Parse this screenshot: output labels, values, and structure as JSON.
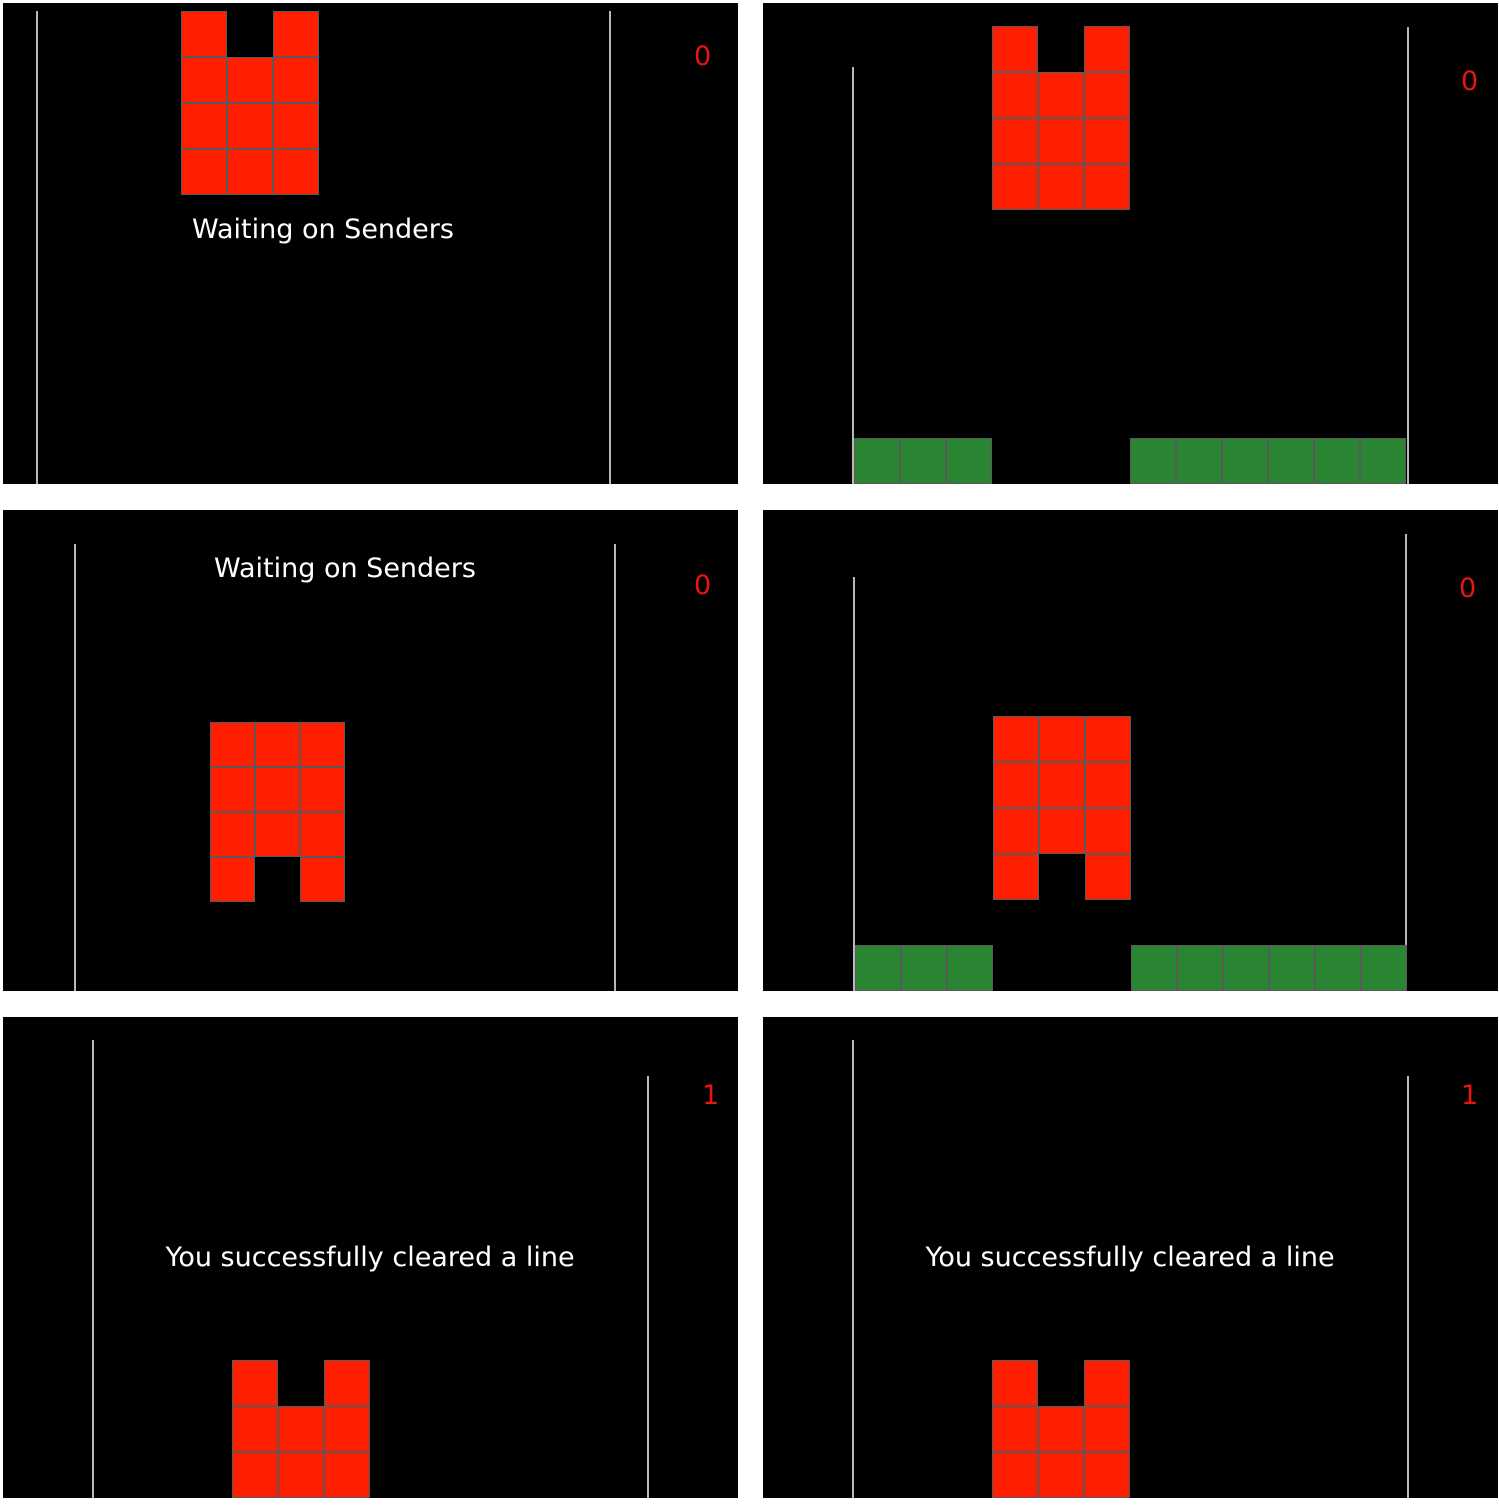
{
  "colors": {
    "background": "#000000",
    "piece": "#ff1e00",
    "stack": "#2a8533",
    "wall": "#b8b8b8",
    "score": "#e8160f",
    "message": "#ffffff",
    "grid_line": "#5a5a5a"
  },
  "panels": [
    {
      "id": "top-left",
      "score": "0",
      "message": "Waiting on Senders",
      "piece": {
        "shape": "U",
        "rows": [
          [
            1,
            0,
            1
          ],
          [
            1,
            1,
            1
          ],
          [
            1,
            1,
            1
          ],
          [
            1,
            1,
            1
          ]
        ]
      },
      "stack": null
    },
    {
      "id": "top-right",
      "score": "0",
      "message": "",
      "piece": {
        "shape": "U",
        "rows": [
          [
            1,
            0,
            1
          ],
          [
            1,
            1,
            1
          ],
          [
            1,
            1,
            1
          ],
          [
            1,
            1,
            1
          ]
        ]
      },
      "stack": {
        "row": [
          1,
          1,
          1,
          0,
          0,
          0,
          1,
          1,
          1,
          1,
          1,
          1
        ]
      }
    },
    {
      "id": "middle-left",
      "score": "0",
      "message": "Waiting on Senders",
      "piece": {
        "shape": "inverted-U",
        "rows": [
          [
            1,
            1,
            1
          ],
          [
            1,
            1,
            1
          ],
          [
            1,
            1,
            1
          ],
          [
            1,
            0,
            1
          ]
        ]
      },
      "stack": null
    },
    {
      "id": "middle-right",
      "score": "0",
      "message": "",
      "piece": {
        "shape": "inverted-U",
        "rows": [
          [
            1,
            1,
            1
          ],
          [
            1,
            1,
            1
          ],
          [
            1,
            1,
            1
          ],
          [
            1,
            0,
            1
          ]
        ]
      },
      "stack": {
        "row": [
          1,
          1,
          1,
          0,
          0,
          0,
          1,
          1,
          1,
          1,
          1,
          1
        ]
      }
    },
    {
      "id": "bottom-left",
      "score": "1",
      "message": "You successfully cleared a line",
      "piece": {
        "shape": "U",
        "rows": [
          [
            1,
            0,
            1
          ],
          [
            1,
            1,
            1
          ],
          [
            1,
            1,
            1
          ]
        ]
      },
      "stack": null
    },
    {
      "id": "bottom-right",
      "score": "1",
      "message": "You successfully cleared a line",
      "piece": {
        "shape": "U",
        "rows": [
          [
            1,
            0,
            1
          ],
          [
            1,
            1,
            1
          ],
          [
            1,
            1,
            1
          ]
        ]
      },
      "stack": null
    }
  ]
}
